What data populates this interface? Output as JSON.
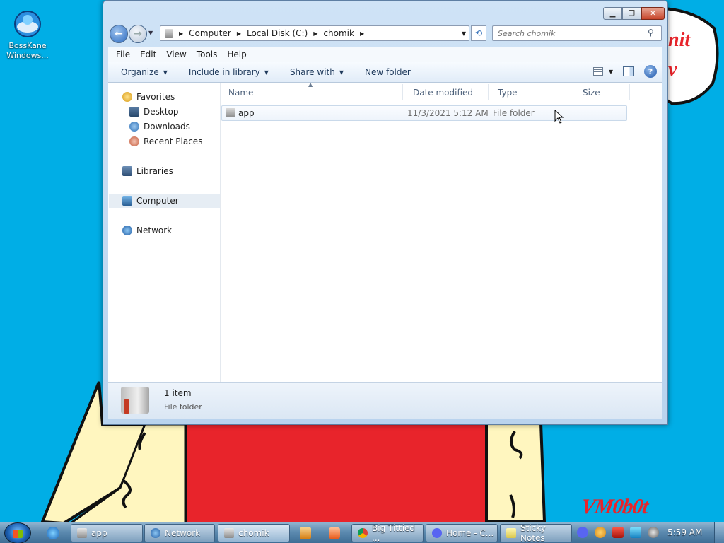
{
  "desktop": {
    "icon_label_line1": "BossKane",
    "icon_label_line2": "Windows...",
    "wallpaper_text": "VM0b0t",
    "bubble_text": "nit\nv"
  },
  "window": {
    "address": {
      "segments": [
        "Computer",
        "Local Disk (C:)",
        "chomik"
      ]
    },
    "search": {
      "placeholder": "Search chomik"
    },
    "menu": [
      "File",
      "Edit",
      "View",
      "Tools",
      "Help"
    ],
    "toolbar": {
      "organize": "Organize",
      "include_in_library": "Include in library",
      "share_with": "Share with",
      "new_folder": "New folder"
    },
    "nav": {
      "favorites": "Favorites",
      "desktop": "Desktop",
      "downloads": "Downloads",
      "recent_places": "Recent Places",
      "libraries": "Libraries",
      "computer": "Computer",
      "network": "Network"
    },
    "columns": {
      "name": "Name",
      "date_modified": "Date modified",
      "type": "Type",
      "size": "Size"
    },
    "files": [
      {
        "name": "app",
        "date_modified": "11/3/2021 5:12 AM",
        "type": "File folder",
        "size": ""
      }
    ],
    "details": {
      "count": "1 item",
      "type": "File folder"
    }
  },
  "taskbar": {
    "items": [
      {
        "label": "app"
      },
      {
        "label": "Network"
      },
      {
        "label": "chomik"
      },
      {
        "label": "Big Tittied ..."
      },
      {
        "label": "Home - C..."
      },
      {
        "label": "Sticky Notes"
      }
    ],
    "clock": "5:59 AM"
  },
  "colors": {
    "wallpaper_blue": "#00aee6",
    "wallpaper_red": "#e8242b",
    "wallpaper_yellow": "#fff6bf"
  }
}
